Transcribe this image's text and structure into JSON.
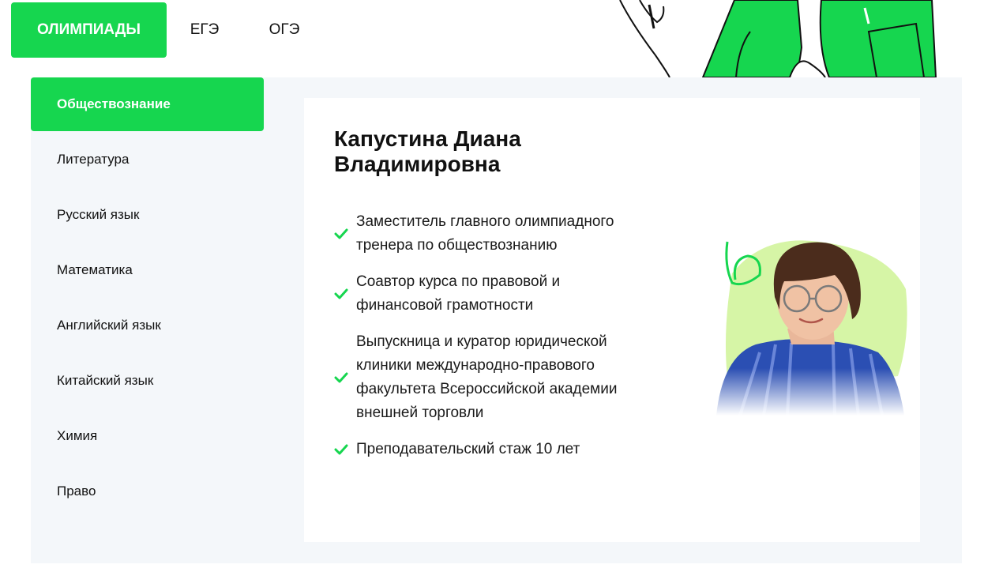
{
  "top_tabs": [
    {
      "label": "ОЛИМПИАДЫ",
      "active": true
    },
    {
      "label": "ЕГЭ",
      "active": false
    },
    {
      "label": "ОГЭ",
      "active": false
    }
  ],
  "sidebar": {
    "items": [
      {
        "label": "Обществознание",
        "active": true
      },
      {
        "label": "Литература",
        "active": false
      },
      {
        "label": "Русский язык",
        "active": false
      },
      {
        "label": "Математика",
        "active": false
      },
      {
        "label": "Английский язык",
        "active": false
      },
      {
        "label": "Китайский язык",
        "active": false
      },
      {
        "label": "Химия",
        "active": false
      },
      {
        "label": "Право",
        "active": false
      }
    ]
  },
  "teacher": {
    "name_line1": "Капустина Диана",
    "name_line2": "Владимировна",
    "facts": [
      "Заместитель главного олимпиадного тренера по обществознанию",
      "Соавтор курса по правовой и финансовой грамотности",
      "Выпускница и куратор юридической клиники международно-правового факультета Всероссийской академии внешней торговли",
      "Преподавательский стаж 10 лет"
    ]
  },
  "icons": {
    "check": "check-icon",
    "illustration": "hands-illustration",
    "photo": "teacher-photo"
  },
  "colors": {
    "accent": "#16d64f",
    "panel_bg": "#f4f7fa",
    "photo_blob": "#d6f5a6"
  }
}
